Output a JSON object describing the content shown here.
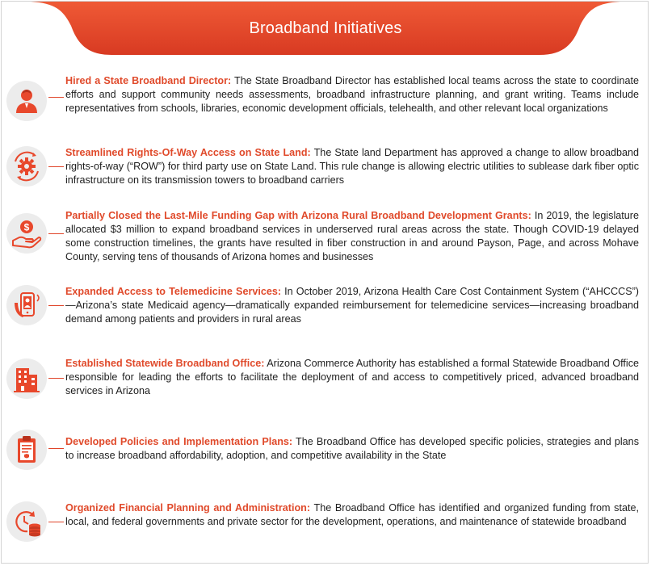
{
  "header": {
    "title": "Broadband Initiatives"
  },
  "colors": {
    "accent": "#e8482c",
    "icon_bg": "#ececec",
    "text": "#1e1e1e"
  },
  "items": [
    {
      "icon": "person-icon",
      "title": "Hired a State Broadband Director:",
      "body": " The State Broadband  Director has established local teams across the state to coordinate efforts and support community needs assessments, broadband infrastructure planning, and grant writing. Teams include representatives from schools, libraries, economic development officials, telehealth, and other relevant local organizations"
    },
    {
      "icon": "gear-cycle-icon",
      "title": "Streamlined Rights-Of-Way  Access  on State Land:",
      "body": " The State land Department has approved  a change to allow broadband rights-of-way (“ROW”) for third party use on State Land. This rule change is allowing electric utilities to sublease dark fiber optic infrastructure on its transmission towers to broadband carriers"
    },
    {
      "icon": "money-hand-icon",
      "title": "Partially Closed the Last-Mile Funding Gap with Arizona Rural Broadband Development Grants:",
      "body": " In 2019, the legislature allocated $3 million to expand broadband  services in underserved  rural areas across the state. Though COVID-19 delayed some construction timelines, the grants have resulted in fiber construction in and around Payson, Page, and across Mohave County, serving tens of thousands of Arizona homes and businesses"
    },
    {
      "icon": "telemedicine-phone-icon",
      "title": "Expanded Access  to Telemedicine Services:",
      "body": "  In October 2019, Arizona Health Care Cost Containment System (“AHCCCS”)—Arizona’s  state Medicaid agency—dramatically expanded reimbursement for telemedicine services—increasing broadband demand among patients and providers in rural areas"
    },
    {
      "icon": "building-icon",
      "title": "Established  Statewide Broadband Office:",
      "body": " Arizona Commerce Authority has established a formal Statewide Broadband Office responsible for leading the efforts to facilitate the deployment of and access to competitively priced, advanced broadband services in Arizona"
    },
    {
      "icon": "clipboard-icon",
      "title": "Developed Policies and Implementation Plans:",
      "body": " The Broadband Office has developed specific policies, strategies and plans to increase broadband affordability, adoption, and competitive availability in the State"
    },
    {
      "icon": "clock-coins-icon",
      "title": "Organized Financial Planning and Administration:",
      "body": " The Broadband Office has identified and organized funding from state, local, and federal governments and private sector for the development, operations, and maintenance of statewide broadband"
    }
  ]
}
